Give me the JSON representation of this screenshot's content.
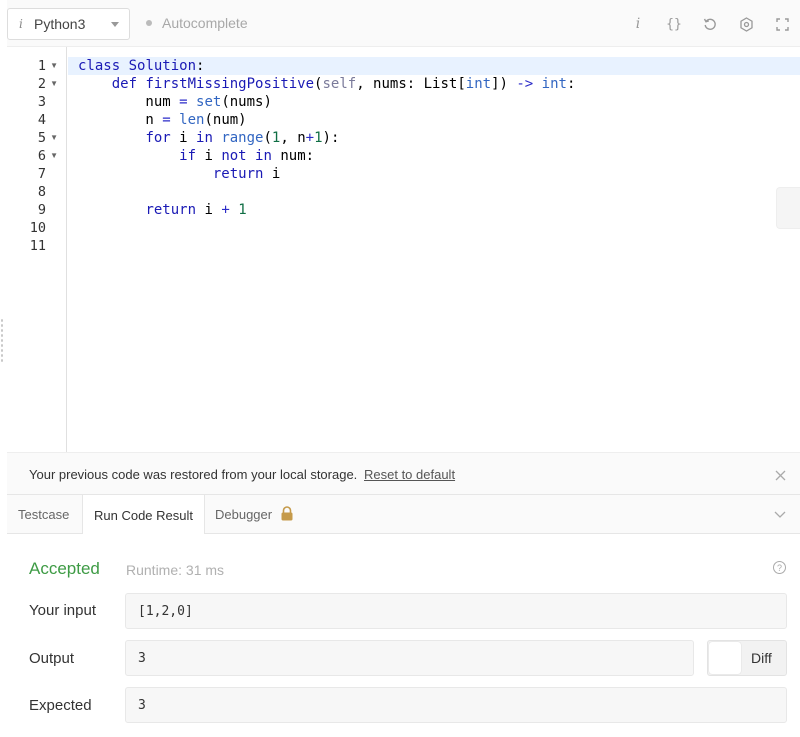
{
  "toolbar": {
    "language": "Python3",
    "language_icon": "i",
    "autocomplete_label": "Autocomplete",
    "icons": [
      "info-icon",
      "braces-icon",
      "reset-icon",
      "settings-icon",
      "fullscreen-icon"
    ],
    "info_glyph": "i",
    "braces_glyph": "{}"
  },
  "editor": {
    "line_numbers": [
      "1",
      "2",
      "3",
      "4",
      "5",
      "6",
      "7",
      "8",
      "9",
      "10",
      "11"
    ],
    "fold_markers": [
      "1",
      "2",
      "5",
      "6"
    ],
    "code": [
      "class Solution:",
      "    def firstMissingPositive(self, nums: List[int]) -> int:",
      "        num = set(nums)",
      "        n = len(num)",
      "        for i in range(1, n+1):",
      "            if i not in num:",
      "                return i",
      "",
      "        return i + 1",
      "",
      ""
    ]
  },
  "notice": {
    "message": "Your previous code was restored from your local storage.",
    "reset_link": "Reset to default"
  },
  "tabs": [
    {
      "label": "Testcase",
      "active": false
    },
    {
      "label": "Run Code Result",
      "active": true
    },
    {
      "label": "Debugger",
      "active": false,
      "locked": true
    }
  ],
  "result": {
    "status": "Accepted",
    "runtime": "Runtime: 31 ms",
    "help_glyph": "?",
    "input_label": "Your input",
    "input_value": "[1,2,0]",
    "output_label": "Output",
    "output_value": "3",
    "expected_label": "Expected",
    "expected_value": "3",
    "diff_label": "Diff"
  },
  "colors": {
    "accepted": "#3e9b45",
    "active_line": "#e8f2ff",
    "keyword": "#1a1ab5",
    "lock": "#c59a4a"
  }
}
